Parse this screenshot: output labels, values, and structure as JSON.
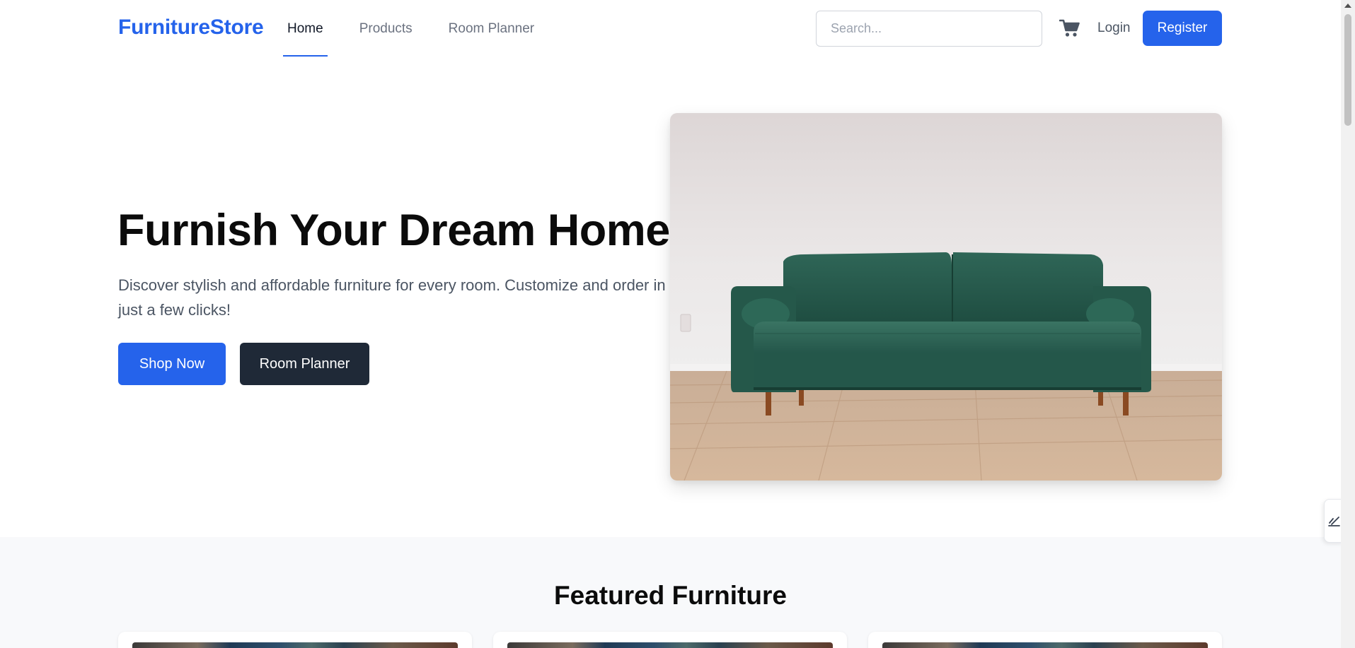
{
  "brand": {
    "name": "FurnitureStore",
    "accent_color": "#2563eb"
  },
  "nav": {
    "items": [
      {
        "label": "Home",
        "active": true
      },
      {
        "label": "Products",
        "active": false
      },
      {
        "label": "Room Planner",
        "active": false
      }
    ]
  },
  "header": {
    "search_placeholder": "Search...",
    "search_value": "",
    "cart_icon": "cart-icon",
    "login_label": "Login",
    "register_label": "Register"
  },
  "hero": {
    "title": "Furnish Your Dream Home",
    "subtitle": "Discover stylish and affordable furniture for every room. Customize and order in just a few clicks!",
    "primary_button": "Shop Now",
    "secondary_button": "Room Planner",
    "image": "green-velvet-sofa-photo"
  },
  "featured": {
    "title": "Featured Furniture",
    "cards": [
      {
        "image": "product-image"
      },
      {
        "image": "product-image"
      },
      {
        "image": "product-image"
      }
    ]
  },
  "colors": {
    "primary_button": "#2563eb",
    "secondary_button": "#1f2937",
    "section_background": "#f8f9fb"
  }
}
